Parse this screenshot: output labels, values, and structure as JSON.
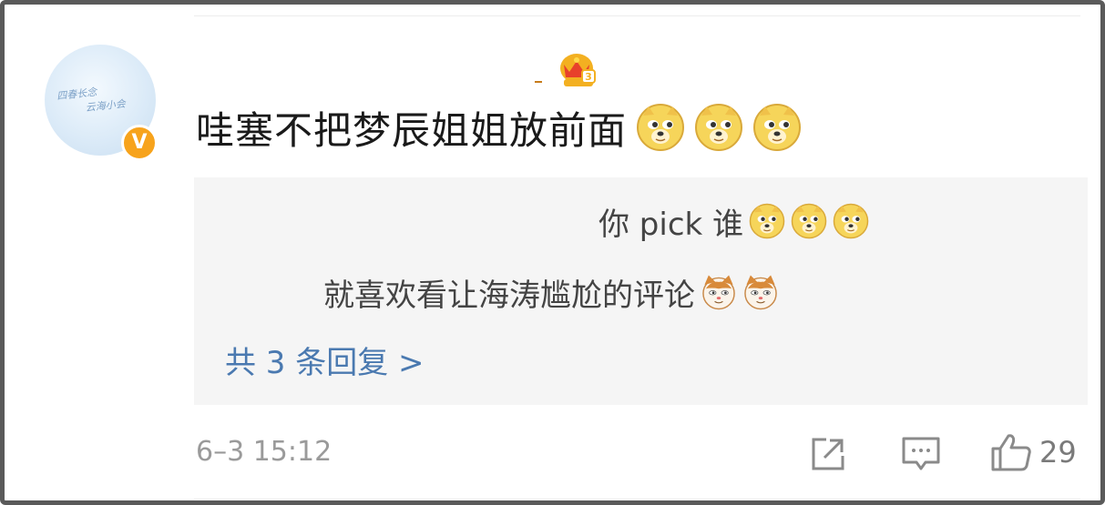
{
  "avatar": {
    "lines": [
      "四春长念",
      "云海小会"
    ],
    "badge": "V"
  },
  "comment": {
    "text": "哇塞不把梦辰姐姐放前面",
    "emoji_count": 3,
    "emoji_name": "doge-icon"
  },
  "replies": [
    {
      "text": "你 pick 谁",
      "emoji_name": "doge-icon",
      "emoji_count": 3
    },
    {
      "text": "就喜欢看让海涛尴尬的评论",
      "emoji_name": "cat-icon",
      "emoji_count": 2
    }
  ],
  "more_replies_label": "共 3 条回复 >",
  "footer": {
    "time": "6–3 15:12",
    "likes": "29"
  },
  "colors": {
    "accent_blue": "#4a79b0",
    "badge_orange": "#f7a31c",
    "crown_gold": "#f3b021",
    "crown_red": "#e8412b"
  }
}
